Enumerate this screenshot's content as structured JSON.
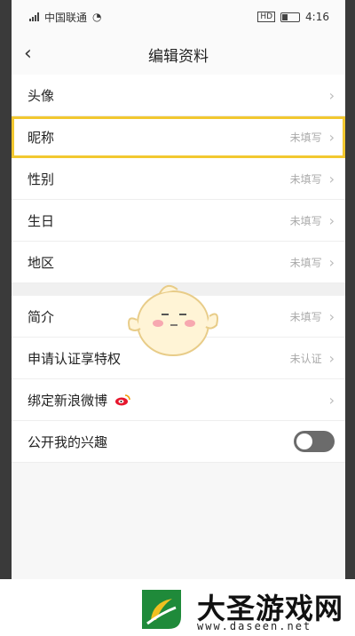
{
  "status": {
    "carrier": "中国联通",
    "time": "4:16",
    "icons": [
      "signal-icon",
      "wifi-icon",
      "hd-icon",
      "battery-icon"
    ]
  },
  "header": {
    "title": "编辑资料",
    "back_icon": "‹"
  },
  "section1": [
    {
      "label": "头像",
      "value": ""
    },
    {
      "label": "昵称",
      "value": "未填写"
    },
    {
      "label": "性别",
      "value": "未填写"
    },
    {
      "label": "生日",
      "value": "未填写"
    },
    {
      "label": "地区",
      "value": "未填写"
    }
  ],
  "section2": [
    {
      "label": "简介",
      "value": "未填写"
    },
    {
      "label": "申请认证享特权",
      "value": "未认证"
    },
    {
      "label": "绑定新浪微博",
      "value": ""
    },
    {
      "label": "公开我的兴趣",
      "toggle_on": false
    }
  ],
  "watermark": {
    "brand": "大圣游戏网",
    "url": "www.daseen.net"
  },
  "colors": {
    "highlight": "#f2c830",
    "toggle_off": "#6b6b6b",
    "weibo_red": "#e6162d"
  }
}
